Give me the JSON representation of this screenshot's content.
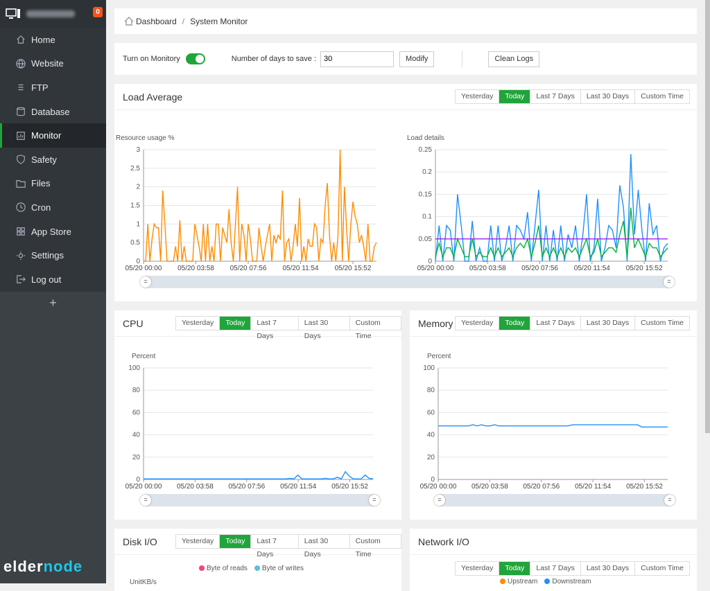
{
  "sidebar": {
    "badge": "0",
    "items": [
      {
        "label": "Home"
      },
      {
        "label": "Website"
      },
      {
        "label": "FTP"
      },
      {
        "label": "Database"
      },
      {
        "label": "Monitor"
      },
      {
        "label": "Safety"
      },
      {
        "label": "Files"
      },
      {
        "label": "Cron"
      },
      {
        "label": "App Store"
      },
      {
        "label": "Settings"
      },
      {
        "label": "Log out"
      }
    ],
    "add": "+",
    "logo": "elder",
    "logo2": "node"
  },
  "breadcrumb": {
    "home": "Dashboard",
    "sep": "/",
    "current": "System Monitor"
  },
  "controls": {
    "monitor_label": "Turn on Monitory",
    "monitor_on": true,
    "days_label": "Number of days to save :",
    "days_value": "30",
    "modify": "Modify",
    "clean": "Clean Logs"
  },
  "tabs": [
    "Yesterday",
    "Today",
    "Last 7 Days",
    "Last 30 Days",
    "Custom Time"
  ],
  "active_tab": "Today",
  "colors": {
    "accent": "#20a53a",
    "orange": "#ff8c00",
    "blue": "#1e90ff",
    "green": "#00b33c",
    "purple": "#a020f0",
    "badge": "#f7521c"
  },
  "load": {
    "title": "Load Average"
  },
  "cpu": {
    "title": "CPU"
  },
  "memory": {
    "title": "Memory"
  },
  "disk": {
    "title": "Disk I/O",
    "legend": [
      "Byte of reads",
      "Byte of writes"
    ],
    "unit": "UnitKB/s"
  },
  "network": {
    "title": "Network I/O",
    "legend": [
      "Upstream",
      "Downstream"
    ]
  },
  "chart_data": [
    {
      "id": "load-resource",
      "type": "line",
      "ylabel": "Resource usage %",
      "ylim": [
        0,
        3
      ],
      "yticks": [
        "0",
        "0.5",
        "1",
        "1.5",
        "2",
        "2.5",
        "3"
      ],
      "xticks": [
        "05/20 00:00",
        "05/20 03:58",
        "05/20 07:56",
        "05/20 11:54",
        "05/20 15:52"
      ],
      "series": [
        {
          "color": "#ff8c00",
          "values": [
            0,
            0,
            1,
            0,
            0.6,
            1,
            0.9,
            0.9,
            0,
            1.9,
            1,
            0,
            0,
            0,
            0,
            0.4,
            0,
            1.1,
            0,
            0.4,
            0,
            0,
            0,
            0,
            1,
            0.7,
            0.4,
            0,
            1,
            0,
            1,
            0,
            0.4,
            0,
            1,
            1,
            0,
            0.9,
            0.7,
            0.5,
            1.4,
            0.5,
            0,
            1,
            2,
            0,
            1,
            0.7,
            0,
            1,
            0.6,
            0,
            0,
            0,
            0.9,
            0.4,
            0,
            0.4,
            0.7,
            1,
            0,
            0.7,
            0.5,
            0.7,
            0.6,
            1.9,
            0,
            0.5,
            0.6,
            0,
            0.4,
            1,
            0.4,
            1.7,
            0,
            0.4,
            0,
            0.6,
            0.4,
            0.4,
            1,
            0.9,
            0,
            0.6,
            0.5,
            1.5,
            2.1,
            0.7,
            0,
            0.5,
            0,
            0.7,
            3,
            0,
            2,
            0.9,
            0,
            1,
            1.6,
            1.2,
            1,
            0.5,
            0.7,
            0.4,
            0,
            1,
            0,
            0,
            0.4,
            0.5
          ]
        }
      ]
    },
    {
      "id": "load-details",
      "type": "line",
      "ylabel": "Load details",
      "ylim": [
        0,
        0.25
      ],
      "yticks": [
        "0",
        "0.05",
        "0.1",
        "0.15",
        "0.2",
        "0.25"
      ],
      "xticks": [
        "05/20 00:00",
        "05/20 03:58",
        "05/20 07:56",
        "05/20 11:54",
        "05/20 15:52"
      ],
      "series": [
        {
          "color": "#1e90ff",
          "values": [
            0,
            0.08,
            0,
            0.08,
            0.07,
            0,
            0.15,
            0.08,
            0,
            0,
            0.09,
            0,
            0.03,
            0,
            0,
            0.08,
            0,
            0.08,
            0,
            0.03,
            0.08,
            0,
            0.08,
            0.07,
            0.05,
            0.11,
            0,
            0.08,
            0.16,
            0,
            0.08,
            0,
            0.07,
            0,
            0.08,
            0,
            0.06,
            0.03,
            0.08,
            0,
            0.06,
            0.15,
            0,
            0.03,
            0.14,
            0,
            0.03,
            0.08,
            0.07,
            0.03,
            0.17,
            0.12,
            0,
            0.24,
            0.06,
            0.16,
            0.07,
            0,
            0.13,
            0.06,
            0.08,
            0,
            0.03,
            0.04
          ]
        },
        {
          "color": "#00b33c",
          "values": [
            0.01,
            0.04,
            0.01,
            0.03,
            0.03,
            0.01,
            0.05,
            0.03,
            0.01,
            0.01,
            0.05,
            0.01,
            0.02,
            0.01,
            0.01,
            0.03,
            0.01,
            0.03,
            0.01,
            0.02,
            0.03,
            0.01,
            0.03,
            0.04,
            0.03,
            0.05,
            0.01,
            0.04,
            0.08,
            0.01,
            0.03,
            0.01,
            0.03,
            0.01,
            0.03,
            0.01,
            0.03,
            0.02,
            0.03,
            0.01,
            0.03,
            0.05,
            0.01,
            0.02,
            0.05,
            0.01,
            0.02,
            0.03,
            0.03,
            0.02,
            0.06,
            0.09,
            0.01,
            0.12,
            0.03,
            0.05,
            0.03,
            0.01,
            0.04,
            0.03,
            0.03,
            0.01,
            0.02,
            0.03
          ]
        },
        {
          "color": "#a020f0",
          "values": [
            0.05,
            0.05,
            0.05,
            0.05,
            0.05,
            0.05
          ]
        }
      ]
    },
    {
      "id": "cpu",
      "type": "line",
      "ylabel": "Percent",
      "ylim": [
        0,
        100
      ],
      "yticks": [
        "0",
        "20",
        "40",
        "60",
        "80",
        "100"
      ],
      "xticks": [
        "05/20 00:00",
        "05/20 03:58",
        "05/20 07:56",
        "05/20 11:54",
        "05/20 15:52"
      ],
      "series": [
        {
          "color": "#1e90ff",
          "values": [
            0.5,
            0.5,
            0.5,
            0.5,
            0.5,
            0.5,
            0.5,
            0.5,
            0.5,
            0.5,
            0.5,
            0.5,
            0.5,
            0.5,
            0.5,
            0.5,
            0.5,
            0.5,
            0.5,
            0.5,
            0.5,
            0.5,
            0.5,
            0.5,
            0.5,
            0.5,
            0.5,
            0.5,
            0.5,
            0.5,
            0.5,
            0.5,
            0.5,
            0.5,
            0.5,
            0.5,
            0.5,
            1,
            0.5,
            4,
            0.5,
            0.5,
            0.5,
            0.5,
            0.5,
            0.5,
            1,
            0.5,
            0.5,
            2,
            0.5,
            7,
            3,
            0.5,
            0.5,
            0.5,
            4,
            1,
            0.5
          ]
        }
      ]
    },
    {
      "id": "memory",
      "type": "line",
      "ylabel": "Percent",
      "ylim": [
        0,
        100
      ],
      "yticks": [
        "0",
        "20",
        "40",
        "60",
        "80",
        "100"
      ],
      "xticks": [
        "05/20 00:00",
        "05/20 03:58",
        "05/20 07:56",
        "05/20 11:54",
        "05/20 15:52"
      ],
      "series": [
        {
          "color": "#1e90ff",
          "values": [
            48,
            48,
            48,
            48,
            48,
            48,
            48,
            48,
            49,
            48,
            49,
            48,
            48,
            49,
            48,
            48,
            48,
            48,
            48,
            48,
            48,
            48,
            48,
            48,
            48,
            48,
            48,
            48,
            48,
            48,
            48,
            49,
            49,
            49,
            49,
            49,
            49,
            49,
            49,
            49,
            49,
            49,
            49,
            49,
            49,
            49,
            49,
            47,
            47,
            47,
            47,
            47,
            47,
            47
          ]
        }
      ]
    }
  ]
}
